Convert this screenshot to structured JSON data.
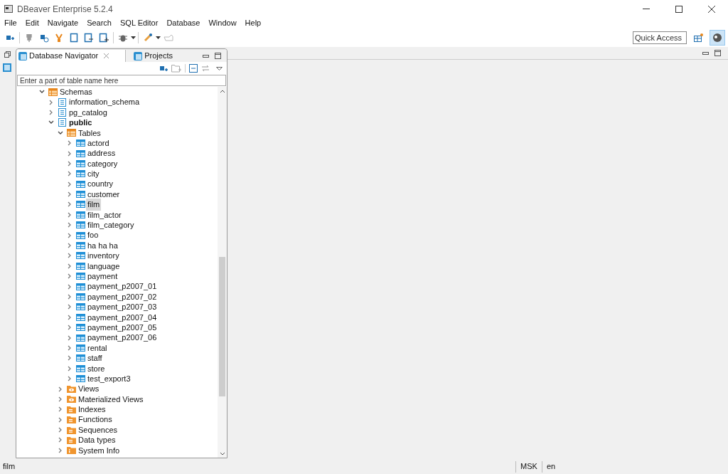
{
  "window": {
    "title": "DBeaver Enterprise 5.2.4"
  },
  "menu": [
    "File",
    "Edit",
    "Navigate",
    "Search",
    "SQL Editor",
    "Database",
    "Window",
    "Help"
  ],
  "quick_access": {
    "placeholder": "Quick Access"
  },
  "panel_tabs": [
    {
      "label": "Database Navigator",
      "selected": true
    },
    {
      "label": "Projects",
      "selected": false
    }
  ],
  "filter": {
    "placeholder": "Enter a part of table name here"
  },
  "tree": [
    {
      "label": "Schemas",
      "kind": "schemas",
      "expanded": true,
      "selected": false,
      "children": [
        {
          "label": "information_schema",
          "kind": "schema",
          "expanded": false,
          "selected": false
        },
        {
          "label": "pg_catalog",
          "kind": "schema",
          "expanded": false,
          "selected": false
        },
        {
          "label": "public",
          "kind": "schema",
          "expanded": true,
          "selected": false,
          "bold": true,
          "children": [
            {
              "label": "Tables",
              "kind": "tables",
              "expanded": true,
              "selected": false,
              "children": [
                {
                  "label": "actord",
                  "kind": "table",
                  "expanded": false,
                  "selected": false
                },
                {
                  "label": "address",
                  "kind": "table",
                  "expanded": false,
                  "selected": false
                },
                {
                  "label": "category",
                  "kind": "table",
                  "expanded": false,
                  "selected": false
                },
                {
                  "label": "city",
                  "kind": "table",
                  "expanded": false,
                  "selected": false
                },
                {
                  "label": "country",
                  "kind": "table",
                  "expanded": false,
                  "selected": false
                },
                {
                  "label": "customer",
                  "kind": "table",
                  "expanded": false,
                  "selected": false
                },
                {
                  "label": "film",
                  "kind": "table",
                  "expanded": false,
                  "selected": true
                },
                {
                  "label": "film_actor",
                  "kind": "table",
                  "expanded": false,
                  "selected": false
                },
                {
                  "label": "film_category",
                  "kind": "table",
                  "expanded": false,
                  "selected": false
                },
                {
                  "label": "foo",
                  "kind": "table",
                  "expanded": false,
                  "selected": false
                },
                {
                  "label": "ha ha ha",
                  "kind": "table",
                  "expanded": false,
                  "selected": false
                },
                {
                  "label": "inventory",
                  "kind": "table",
                  "expanded": false,
                  "selected": false
                },
                {
                  "label": "language",
                  "kind": "table",
                  "expanded": false,
                  "selected": false
                },
                {
                  "label": "payment",
                  "kind": "table",
                  "expanded": false,
                  "selected": false
                },
                {
                  "label": "payment_p2007_01",
                  "kind": "table",
                  "expanded": false,
                  "selected": false
                },
                {
                  "label": "payment_p2007_02",
                  "kind": "table",
                  "expanded": false,
                  "selected": false
                },
                {
                  "label": "payment_p2007_03",
                  "kind": "table",
                  "expanded": false,
                  "selected": false
                },
                {
                  "label": "payment_p2007_04",
                  "kind": "table",
                  "expanded": false,
                  "selected": false
                },
                {
                  "label": "payment_p2007_05",
                  "kind": "table",
                  "expanded": false,
                  "selected": false
                },
                {
                  "label": "payment_p2007_06",
                  "kind": "table",
                  "expanded": false,
                  "selected": false
                },
                {
                  "label": "rental",
                  "kind": "table",
                  "expanded": false,
                  "selected": false
                },
                {
                  "label": "staff",
                  "kind": "table",
                  "expanded": false,
                  "selected": false
                },
                {
                  "label": "store",
                  "kind": "table",
                  "expanded": false,
                  "selected": false
                },
                {
                  "label": "test_export3",
                  "kind": "table",
                  "expanded": false,
                  "selected": false
                }
              ]
            },
            {
              "label": "Views",
              "kind": "views",
              "expanded": false,
              "selected": false
            },
            {
              "label": "Materialized Views",
              "kind": "views",
              "expanded": false,
              "selected": false
            },
            {
              "label": "Indexes",
              "kind": "folder",
              "expanded": false,
              "selected": false
            },
            {
              "label": "Functions",
              "kind": "folder",
              "expanded": false,
              "selected": false
            },
            {
              "label": "Sequences",
              "kind": "folder",
              "expanded": false,
              "selected": false
            },
            {
              "label": "Data types",
              "kind": "folder",
              "expanded": false,
              "selected": false
            },
            {
              "label": "System Info",
              "kind": "info",
              "expanded": false,
              "selected": false
            }
          ]
        }
      ]
    }
  ],
  "status_bar": {
    "selection": "film",
    "timezone": "MSK",
    "locale": "en"
  }
}
